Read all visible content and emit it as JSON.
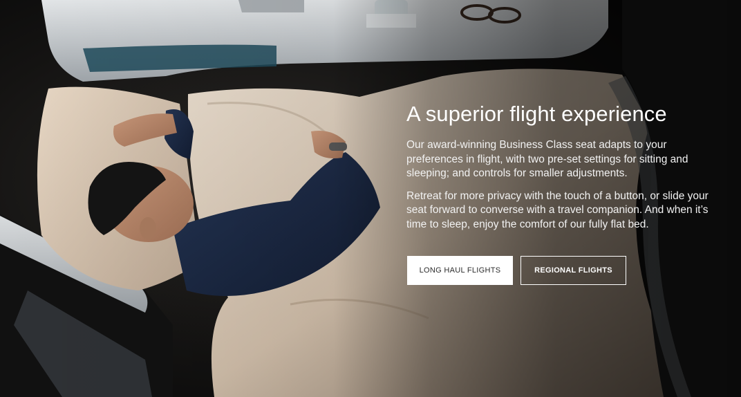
{
  "hero": {
    "image_alt": "Passenger sleeping in fully flat Business Class seat",
    "title": "A superior flight experience",
    "paragraphs": [
      "Our award-winning Business Class seat adapts to your preferences in flight, with two pre-set settings for sitting and sleeping; and controls for smaller adjustments.",
      "Retreat for more privacy with the touch of a button, or slide your seat forward to converse with a travel companion. And when it’s time to sleep, enjoy the comfort of our fully flat bed."
    ],
    "buttons": {
      "long_haul": "LONG HAUL FLIGHTS",
      "regional": "REGIONAL FLIGHTS"
    }
  },
  "colors": {
    "background": "#0b0b0c",
    "text": "#ffffff",
    "button_primary_bg": "#ffffff",
    "button_primary_text": "#2b2b2b",
    "blanket": "#d8c7b5",
    "pillow": "#d9c6b1",
    "sweater": "#1b2a47",
    "seat_shell": "#cfd3d6"
  }
}
